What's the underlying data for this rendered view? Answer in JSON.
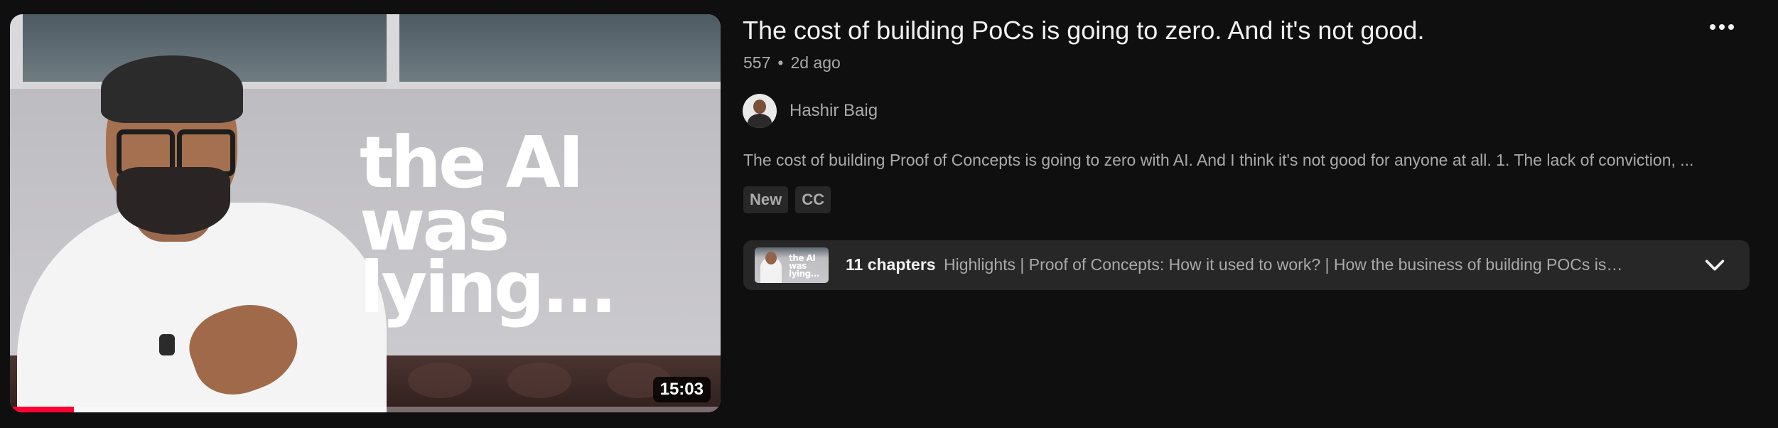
{
  "video": {
    "title": "The cost of building PoCs is going to zero. And it's not good.",
    "views": "557",
    "separator": "•",
    "age": "2d ago",
    "duration": "15:03",
    "watch_progress": 0.09,
    "thumbnail_text_line1": "the AI was",
    "thumbnail_text_line2": "lying...",
    "more_icon": "more-vert-icon"
  },
  "channel": {
    "name": "Hashir Baig"
  },
  "description": "The cost of building Proof of Concepts is going to zero with AI. And I think it's not good for anyone at all. 1. The lack of conviction, ...",
  "badges": [
    "New",
    "CC"
  ],
  "chapters": {
    "count_label": "11 chapters",
    "list": "Highlights | Proof of Concepts: How it used to work? | How the business of building POCs is…",
    "thumb_text_line1": "the AI was",
    "thumb_text_line2": "lying...",
    "expand_icon": "chevron-down-icon"
  },
  "colors": {
    "background": "#0f0f0f",
    "primary_text": "#f1f1f1",
    "secondary_text": "#aaaaaa",
    "chip": "#272727",
    "progress": "#ff0033"
  }
}
